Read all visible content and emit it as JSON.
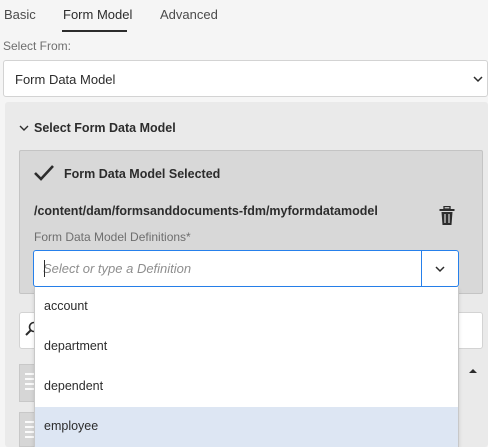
{
  "tabs": [
    {
      "label": "Basic"
    },
    {
      "label": "Form Model"
    },
    {
      "label": "Advanced"
    }
  ],
  "active_tab": "Form Model",
  "select_from": {
    "label": "Select From:",
    "value": "Form Data Model"
  },
  "section": {
    "title": "Select Form Data Model",
    "expanded": true
  },
  "fdm": {
    "status": "Form Data Model Selected",
    "path": "/content/dam/formsanddocuments-fdm/myformdatamodel",
    "definitions_label": "Form Data Model Definitions*",
    "definitions_placeholder": "Select or type a Definition",
    "definitions_value": ""
  },
  "dropdown": {
    "options": [
      {
        "label": "account"
      },
      {
        "label": "department"
      },
      {
        "label": "dependent"
      },
      {
        "label": "employee"
      }
    ],
    "hovered": "employee"
  },
  "colors": {
    "accent": "#2680eb",
    "hover": "#dde6f3"
  },
  "icons": [
    "checkmark-icon",
    "trash-icon",
    "chevron-down-icon",
    "search-icon",
    "chevron-up-icon"
  ]
}
